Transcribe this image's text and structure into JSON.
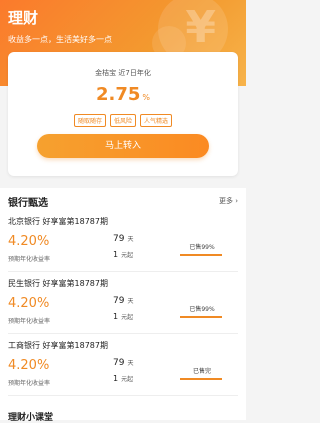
{
  "header": {
    "title": "理财",
    "subtitle": "收益多一点，生活美好多一点"
  },
  "highlight": {
    "rate_label": "金桔宝 近7日年化",
    "rate_value": "2.75",
    "rate_unit": "%",
    "tags": [
      "随取随存",
      "低风险",
      "人气精选"
    ],
    "cta": "马上转入"
  },
  "bank_section": {
    "title": "银行甄选",
    "more": "更多 ›",
    "products": [
      {
        "name": "北京银行 好享富第18787期",
        "rate": "4.20%",
        "rate_caption": "预期年化收益率",
        "days": "79",
        "days_unit": "天",
        "min": "1",
        "min_unit": "元起",
        "status": "已售99%",
        "progress": 0.99
      },
      {
        "name": "民生银行 好享富第18787期",
        "rate": "4.20%",
        "rate_caption": "预期年化收益率",
        "days": "79",
        "days_unit": "天",
        "min": "1",
        "min_unit": "元起",
        "status": "已售99%",
        "progress": 0.99
      },
      {
        "name": "工商银行 好享富第18787期",
        "rate": "4.20%",
        "rate_caption": "预期年化收益率",
        "days": "79",
        "days_unit": "天",
        "min": "1",
        "min_unit": "元起",
        "status": "已售完",
        "progress": 1.0
      }
    ]
  },
  "next_section": {
    "title": "理财小课堂"
  }
}
